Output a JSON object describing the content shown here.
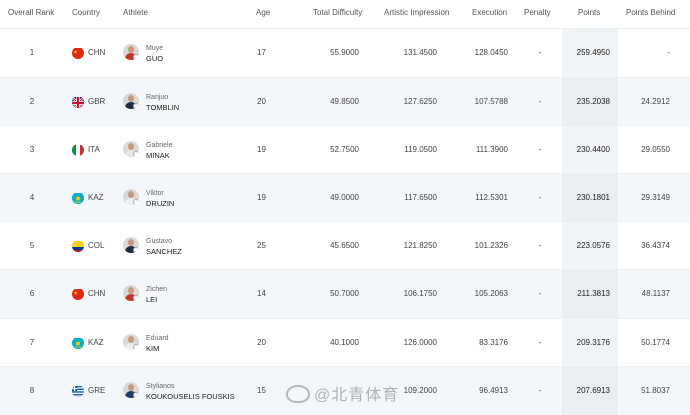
{
  "headers": {
    "rank": "Overall Rank",
    "country": "Country",
    "athlete": "Athlete",
    "age": "Age",
    "difficulty": "Total Difficulty",
    "artistic": "Artistic Impression",
    "execution": "Execution",
    "penalty": "Penalty",
    "points": "Points",
    "behind": "Points Behind"
  },
  "rows": [
    {
      "rank": "1",
      "country": "CHN",
      "first": "Muye",
      "last": "GUO",
      "age": "17",
      "difficulty": "55.9000",
      "artistic": "131.4500",
      "execution": "128.0450",
      "penalty": "-",
      "points": "259.4950",
      "behind": "-",
      "flag": "china",
      "shirt": "#c0392b"
    },
    {
      "rank": "2",
      "country": "GBR",
      "first": "Ranjuo",
      "last": "TOMBLIN",
      "age": "20",
      "difficulty": "49.8500",
      "artistic": "127.6250",
      "execution": "107.5788",
      "penalty": "-",
      "points": "235.2038",
      "behind": "24.2912",
      "flag": "uk",
      "shirt": "#1f2a44"
    },
    {
      "rank": "3",
      "country": "ITA",
      "first": "Gabriele",
      "last": "MINAK",
      "age": "19",
      "difficulty": "52.7500",
      "artistic": "119.0500",
      "execution": "111.3900",
      "penalty": "-",
      "points": "230.4400",
      "behind": "29.0550",
      "flag": "italy",
      "shirt": "#e8e8e8"
    },
    {
      "rank": "4",
      "country": "KAZ",
      "first": "Viktor",
      "last": "DRUZIN",
      "age": "19",
      "difficulty": "49.0000",
      "artistic": "117.6500",
      "execution": "112.5301",
      "penalty": "-",
      "points": "230.1801",
      "behind": "29.3149",
      "flag": "kazakhstan",
      "shirt": "#f0f0f0"
    },
    {
      "rank": "5",
      "country": "COL",
      "first": "Gustavo",
      "last": "SANCHEZ",
      "age": "25",
      "difficulty": "45.6500",
      "artistic": "121.8250",
      "execution": "101.2326",
      "penalty": "-",
      "points": "223.0576",
      "behind": "36.4374",
      "flag": "colombia",
      "shirt": "#1f2a44"
    },
    {
      "rank": "6",
      "country": "CHN",
      "first": "Zichen",
      "last": "LEI",
      "age": "14",
      "difficulty": "50.7000",
      "artistic": "106.1750",
      "execution": "105.2063",
      "penalty": "-",
      "points": "211.3813",
      "behind": "48.1137",
      "flag": "china",
      "shirt": "#c0392b"
    },
    {
      "rank": "7",
      "country": "KAZ",
      "first": "Eduard",
      "last": "KIM",
      "age": "20",
      "difficulty": "40.1000",
      "artistic": "126.0000",
      "execution": "83.3176",
      "penalty": "-",
      "points": "209.3176",
      "behind": "50.1774",
      "flag": "kazakhstan",
      "shirt": "#f0f0f0"
    },
    {
      "rank": "8",
      "country": "GRE",
      "first": "Stylianos",
      "last": "KOUKOUSELIS FOUSKIS",
      "age": "15",
      "difficulty": "",
      "artistic": "109.2000",
      "execution": "96.4913",
      "penalty": "-",
      "points": "207.6913",
      "behind": "51.8037",
      "flag": "greece",
      "shirt": "#1f3a6b"
    }
  ],
  "watermark": "@北青体育"
}
